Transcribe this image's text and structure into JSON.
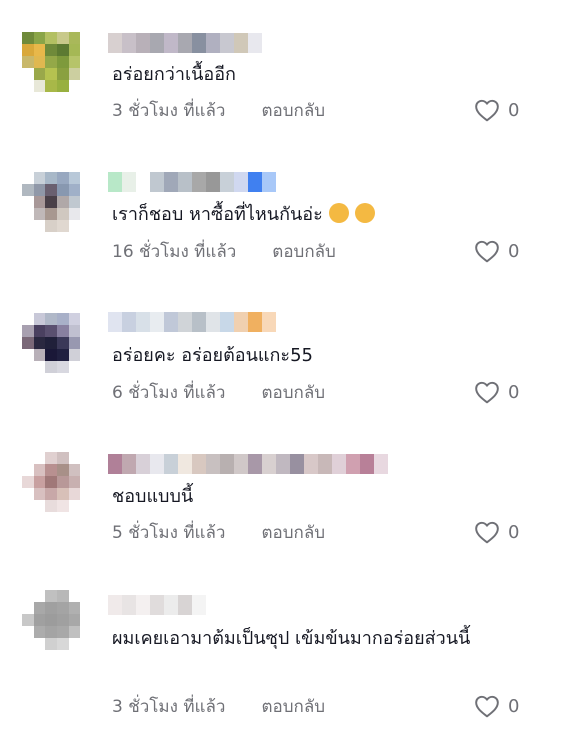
{
  "comments": [
    {
      "text": "อร่อยกว่าเนื้ออีก",
      "time": "3 ชั่วโมง ที่แล้ว",
      "reply": "ตอบกลับ",
      "likes": "0",
      "avatar_colors": [
        "#6f8a3a",
        "#8aa548",
        "#b3c062",
        "#c8c98a",
        "#a9b85a",
        "#ffffff",
        "#d9a83a",
        "#e8b84a",
        "#6f8a3a",
        "#5c7a32",
        "#a5b855",
        "#ffffff",
        "#c9b86a",
        "#e0b850",
        "#94a848",
        "#7e9a3c",
        "#b6c46a",
        "#ffffff",
        "#ffffff",
        "#9aa84a",
        "#b5c250",
        "#8aa040",
        "#cccfa0",
        "#ffffff",
        "#ffffff",
        "#e8e8d8",
        "#a8b848",
        "#98b040",
        "#ffffff",
        "#ffffff"
      ],
      "name_colors": [
        "#d8d0d0",
        "#c8c0c8",
        "#b8b0b8",
        "#a8a8b0",
        "#c0b8c8",
        "#a8a8b0",
        "#8890a0",
        "#b0b0c0",
        "#c8c8d0",
        "#d0c8b8",
        "#e8e8ee"
      ]
    },
    {
      "text": "เราก็ชอบ หาซื้อที่ไหนกันอ่ะ",
      "time": "16 ชั่วโมง ที่แล้ว",
      "reply": "ตอบกลับ",
      "likes": "0",
      "avatar_colors": [
        "#ffffff",
        "#c8d0d8",
        "#a8b8c8",
        "#98a8c0",
        "#b8c8d8",
        "#ffffff",
        "#b0b8c0",
        "#9098a8",
        "#6a6070",
        "#8898b0",
        "#a0b0c8",
        "#ffffff",
        "#ffffff",
        "#a89898",
        "#4a4048",
        "#b0a8a8",
        "#c0c8d0",
        "#ffffff",
        "#ffffff",
        "#c0b8b8",
        "#a89890",
        "#d0c8c0",
        "#e8e8ec",
        "#ffffff",
        "#ffffff",
        "#ffffff",
        "#d8d0c8",
        "#e0d8d0",
        "#ffffff",
        "#ffffff"
      ],
      "name_colors": [
        "#b8e8c8",
        "#e8f0e8",
        "#ffffff",
        "#c0c8d0",
        "#a0a8b8",
        "#b8c0c8",
        "#a8a8a8",
        "#989898",
        "#c8d0d8",
        "#d0d8f0",
        "#4080f0",
        "#a8c8f8"
      ],
      "emojis": [
        "#f2b13d",
        "#f2b13d"
      ]
    },
    {
      "text": "อร่อยคะ อร่อยต้อนแกะ55",
      "time": "6 ชั่วโมง ที่แล้ว",
      "reply": "ตอบกลับ",
      "likes": "0",
      "avatar_colors": [
        "#ffffff",
        "#c8c8d8",
        "#b0b8c8",
        "#a8b0c8",
        "#d0d0e0",
        "#ffffff",
        "#a8a0b0",
        "#4a4060",
        "#5a5070",
        "#8880a0",
        "#c0c0d0",
        "#ffffff",
        "#7a6878",
        "#2a2840",
        "#20203a",
        "#3a3858",
        "#9898b0",
        "#ffffff",
        "#ffffff",
        "#b8b0b8",
        "#1a1838",
        "#202040",
        "#d0d0d8",
        "#ffffff",
        "#ffffff",
        "#ffffff",
        "#d0d0d8",
        "#d8d8e0",
        "#ffffff",
        "#ffffff"
      ],
      "name_colors": [
        "#e0e4f0",
        "#c8d0e0",
        "#d8e0e8",
        "#e8ecf0",
        "#c0c8d8",
        "#d0d4d8",
        "#b8c0c8",
        "#e0e4e8",
        "#c8d8e8",
        "#f0d0b0",
        "#f0b060",
        "#f8d8b8"
      ]
    },
    {
      "text": "ชอบแบบนี้",
      "time": "5 ชั่วโมง ที่แล้ว",
      "reply": "ตอบกลับ",
      "likes": "0",
      "avatar_colors": [
        "#ffffff",
        "#ffffff",
        "#e0d0d0",
        "#d0c0c0",
        "#ffffff",
        "#ffffff",
        "#ffffff",
        "#d8c0c0",
        "#b89090",
        "#a89088",
        "#d0c0c0",
        "#ffffff",
        "#e8d8d8",
        "#c8a0a0",
        "#a07878",
        "#b89898",
        "#c8b0b0",
        "#ffffff",
        "#ffffff",
        "#d8c0c0",
        "#c8a8a8",
        "#d8c0b8",
        "#e8d8d8",
        "#ffffff",
        "#ffffff",
        "#ffffff",
        "#e8dcdc",
        "#f0e4e4",
        "#ffffff",
        "#ffffff"
      ],
      "name_colors": [
        "#b08098",
        "#c0a8b0",
        "#d8d0d8",
        "#e8e8ee",
        "#c8d0d8",
        "#f0e8e0",
        "#d8c8c0",
        "#c8c0c0",
        "#b8b0b0",
        "#d0c8c8",
        "#a898a8",
        "#d8d0d0",
        "#c0b8c0",
        "#9890a0",
        "#d8c8c8",
        "#c8b8b8",
        "#e0d0d8",
        "#d0a0b0",
        "#b88098",
        "#e8d8e0"
      ]
    },
    {
      "text": "ผมเคยเอามาต้มเป็นซุป เข้มข้นมากอร่อยส่วนนี้",
      "time": "3 ชั่วโมง ที่แล้ว",
      "reply": "ตอบกลับ",
      "likes": "0",
      "avatar_colors": [
        "#ffffff",
        "#ffffff",
        "#c0c0c0",
        "#b8b8b8",
        "#ffffff",
        "#ffffff",
        "#ffffff",
        "#a8a8a8",
        "#a0a0a0",
        "#a4a4a4",
        "#b0b0b0",
        "#ffffff",
        "#c8c8c8",
        "#a0a0a0",
        "#9c9c9c",
        "#a0a0a0",
        "#a8a8a8",
        "#ffffff",
        "#ffffff",
        "#acacac",
        "#a4a4a4",
        "#a8a8a8",
        "#c0c0c0",
        "#ffffff",
        "#ffffff",
        "#ffffff",
        "#d0d0d0",
        "#d8d8d8",
        "#ffffff",
        "#ffffff"
      ],
      "name_colors": [
        "#f0eaea",
        "#e8e4e4",
        "#f4f0f0",
        "#e0dcdc",
        "#ececec",
        "#d8d4d4",
        "#f4f4f4"
      ]
    }
  ]
}
